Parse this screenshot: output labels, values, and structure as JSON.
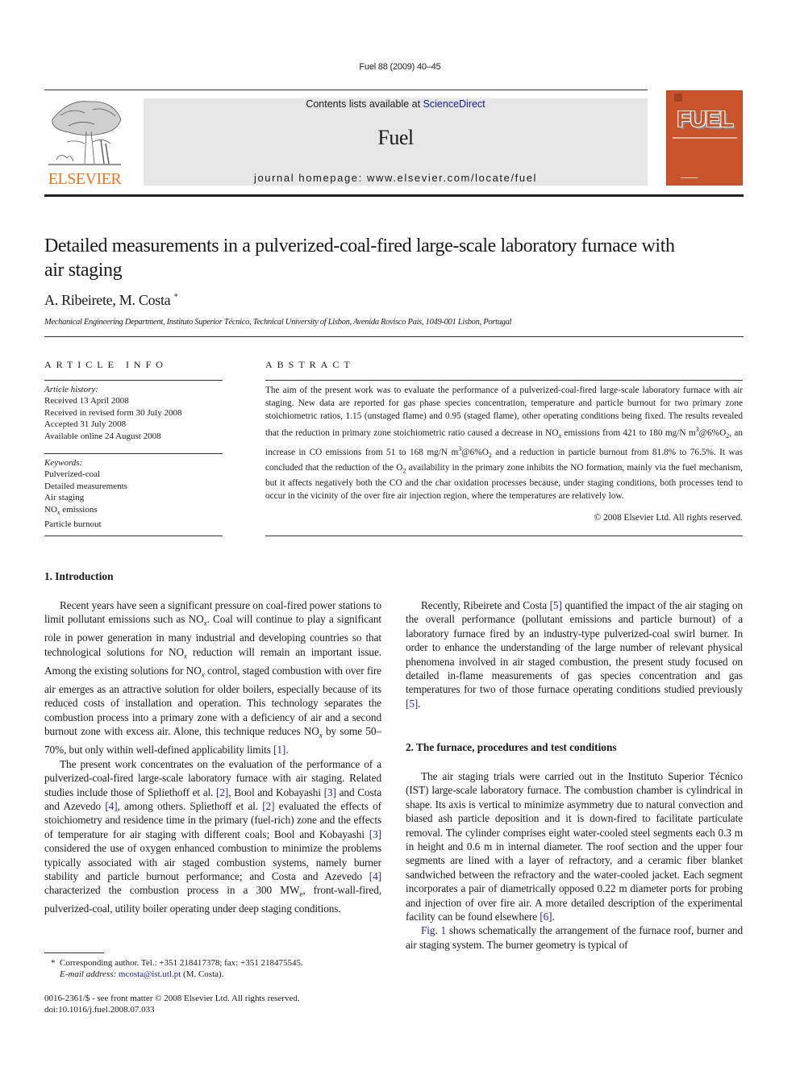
{
  "running_head": "Fuel 88 (2009) 40–45",
  "masthead": {
    "contents_prefix": "Contents lists available at ",
    "contents_link": "ScienceDirect",
    "journal_title": "Fuel",
    "homepage": "journal homepage: www.elsevier.com/locate/fuel",
    "publisher_logo_text": "ELSEVIER",
    "cover_word": "FUEL",
    "colors": {
      "publisher_orange": "#e87722",
      "cover": "#c9532b",
      "masthead_bg": "#e6e6e6",
      "link": "#1a1a9a"
    }
  },
  "article": {
    "title": "Detailed measurements in a pulverized-coal-fired large-scale laboratory furnace with air staging",
    "authors": "A. Ribeirete, M. Costa",
    "author_mark": "*",
    "affiliation": "Mechanical Engineering Department, Instituto Superior Técnico, Technical University of Lisbon, Avenida Rovisco Pais, 1049-001 Lisbon, Portugal"
  },
  "article_info": {
    "heading": "ARTICLE INFO",
    "history_label": "Article history:",
    "history": [
      "Received 13 April 2008",
      "Received in revised form 30 July 2008",
      "Accepted 31 July 2008",
      "Available online 24 August 2008"
    ],
    "keywords_label": "Keywords:",
    "keywords": [
      "Pulverized-coal",
      "Detailed measurements",
      "Air staging",
      "NOx emissions",
      "Particle burnout"
    ]
  },
  "abstract": {
    "heading": "ABSTRACT",
    "p1": "The aim of the present work was to evaluate the performance of a pulverized-coal-fired large-scale laboratory furnace with air staging. New data are reported for gas phase species concentration, temperature and particle burnout for two primary zone stoichiometric ratios, 1.15 (unstaged flame) and 0.95 (staged flame), other operating conditions being fixed. The results revealed that the reduction in primary zone stoichiometric ratio caused a decrease in ",
    "nox": "NO",
    "p2": " emissions from 421 to 180 mg/N m",
    "p3": "@6%O",
    "p4": ", an increase in CO emissions from 51 to 168 mg/N m",
    "p5": " and a reduction in particle burnout from 81.8% to 76.5%. It was concluded that the reduction of the O",
    "p6": " availability in the primary zone inhibits the NO formation, mainly via the fuel mechanism, but it affects negatively both the CO and the char oxidation processes because, under staging conditions, both processes tend to occur in the vicinity of the over fire air injection region, where the temperatures are relatively low.",
    "copyright": "© 2008 Elsevier Ltd. All rights reserved."
  },
  "section1": {
    "heading": "1. Introduction",
    "para1": [
      "Recent years have seen a significant pressure on coal-fired power stations to limit pollutant emissions such as NO",
      ". Coal will continue to play a significant role in power generation in many industrial and developing countries so that technological solutions for NO",
      " reduction will remain an important issue. Among the existing solutions for NO",
      " control, staged combustion with over fire air emerges as an attractive solution for older boilers, especially because of its reduced costs of installation and operation. This technology separates the combustion process into a primary zone with a deficiency of air and a second burnout zone with excess air. Alone, this technique reduces NO",
      " by some 50–70%, but only within well-defined applicability limits ",
      "."
    ],
    "para2": [
      "The present work concentrates on the evaluation of the performance of a pulverized-coal-fired large-scale laboratory furnace with air staging. Related studies include those of Spliethoff et al. ",
      ", Bool and Kobayashi ",
      " and Costa and Azevedo ",
      ", among others. Spliethoff et al. ",
      " evaluated the effects of stoichiometry and residence time in the primary (fuel-rich) zone and the effects of temperature for air staging with different coals; Bool and Kobayashi ",
      " considered the use of oxygen enhanced combustion to minimize the problems typically associated with air staged combustion systems, namely burner stability and particle burnout performance; and Costa and Azevedo ",
      " characterized the combustion process in a 300 MW",
      ", front-wall-fired, pulverized-coal, utility boiler operating under deep staging conditions."
    ],
    "para3": [
      "Recently, Ribeirete and Costa ",
      " quantified the impact of the air staging on the overall performance (pollutant emissions and particle burnout) of a laboratory furnace fired by an industry-type pulverized-coal swirl burner. In order to enhance the understanding of the large number of relevant physical phenomena involved in air staged combustion, the present study focused on detailed in-flame measurements of gas species concentration and gas temperatures for two of those furnace operating conditions studied previously ",
      "."
    ],
    "refs": {
      "r1": "[1]",
      "r2": "[2]",
      "r3": "[3]",
      "r4": "[4]",
      "r5": "[5]",
      "r6": "[6]"
    },
    "sub_x": "x",
    "sub_e": "e",
    "sub_2": "2",
    "sup_3": "3"
  },
  "section2": {
    "heading": "2. The furnace, procedures and test conditions",
    "para1": [
      "The air staging trials were carried out in the Instituto Superior Técnico (IST) large-scale laboratory furnace. The combustion chamber is cylindrical in shape. Its axis is vertical to minimize asymmetry due to natural convection and biased ash particle deposition and it is down-fired to facilitate particulate removal. The cylinder comprises eight water-cooled steel segments each 0.3 m in height and 0.6 m in internal diameter. The roof section and the upper four segments are lined with a layer of refractory, and a ceramic fiber blanket sandwiched between the refractory and the water-cooled jacket. Each segment incorporates a pair of diametrically opposed 0.22 m diameter ports for probing and injection of over fire air. A more detailed description of the experimental facility can be found elsewhere ",
      "."
    ],
    "fig_ref": "Fig. 1",
    "para2": " shows schematically the arrangement of the furnace roof, burner and air staging system. The burner geometry is typical of"
  },
  "footnote": {
    "mark": "*",
    "text": "Corresponding author. Tel.: +351 218417378; fax: +351 218475545.",
    "email_label": "E-mail address:",
    "email": "mcosta@ist.utl.pt",
    "email_suffix": " (M. Costa)."
  },
  "footer": {
    "issn_line": "0016-2361/$ - see front matter © 2008 Elsevier Ltd. All rights reserved.",
    "doi": "doi:10.1016/j.fuel.2008.07.033"
  }
}
